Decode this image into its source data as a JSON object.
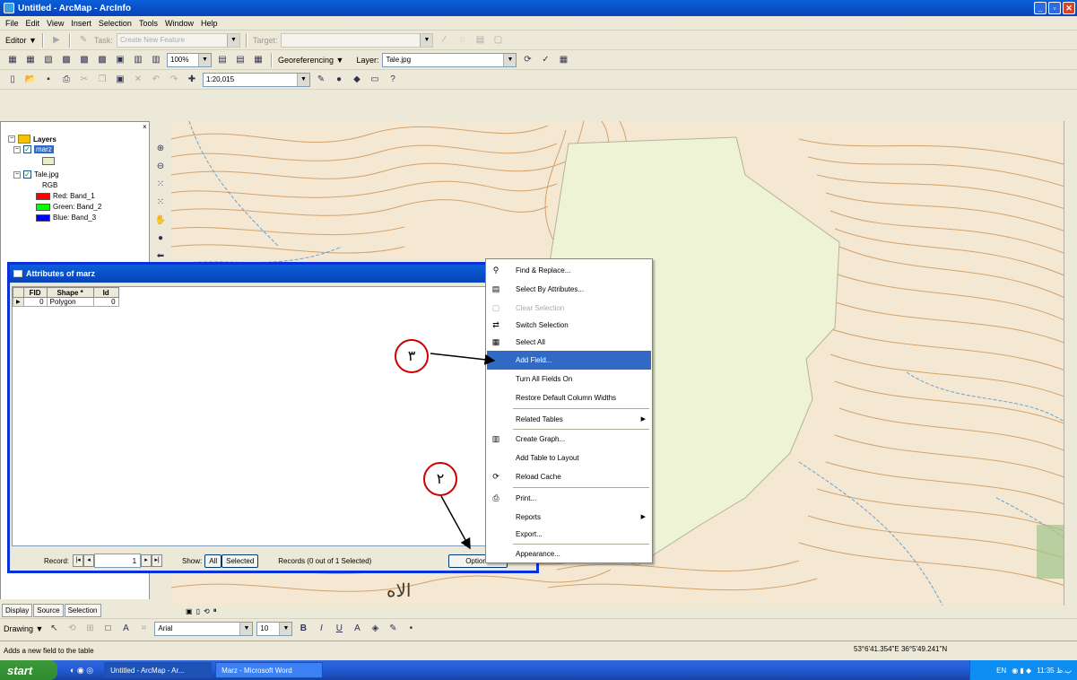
{
  "window": {
    "title": "Untitled - ArcMap - ArcInfo"
  },
  "menu": [
    "File",
    "Edit",
    "View",
    "Insert",
    "Selection",
    "Tools",
    "Window",
    "Help"
  ],
  "editor_toolbar": {
    "editor": "Editor ▼",
    "task_label": "Task:",
    "task_value": "Create New Feature",
    "target_label": "Target:"
  },
  "georef_toolbar": {
    "zoom": "100%",
    "georeferencing": "Georeferencing ▼",
    "layer_label": "Layer:",
    "layer_value": "Tale.jpg"
  },
  "standard_toolbar": {
    "scale": "1:20,015"
  },
  "toc": {
    "layers": "Layers",
    "marz": "marz",
    "tale": "Tale.jpg",
    "rgb": "RGB",
    "bands": [
      {
        "label": "Red:  Band_1",
        "color": "#ff0000"
      },
      {
        "label": "Green: Band_2",
        "color": "#00ff00"
      },
      {
        "label": "Blue:  Band_3",
        "color": "#0000ff"
      }
    ],
    "tabs": [
      "Display",
      "Source",
      "Selection"
    ]
  },
  "attributes": {
    "title": "Attributes of marz",
    "columns": [
      "FID",
      "Shape *",
      "Id"
    ],
    "rows": [
      [
        "0",
        "Polygon",
        "0"
      ]
    ],
    "record_label": "Record:",
    "record_value": "1",
    "show_label": "Show:",
    "all_btn": "All",
    "selected_btn": "Selected",
    "records_status": "Records (0 out of 1 Selected)",
    "options_btn": "Options"
  },
  "context_menu": [
    {
      "label": "Find & Replace...",
      "icon": "binoculars-icon"
    },
    {
      "label": "Select By Attributes...",
      "icon": "select-attributes-icon"
    },
    {
      "label": "Clear Selection",
      "icon": "clear-selection-icon",
      "disabled": true
    },
    {
      "label": "Switch Selection",
      "icon": "switch-selection-icon"
    },
    {
      "label": "Select All",
      "icon": "select-all-icon"
    },
    {
      "label": "Add Field...",
      "highlight": true
    },
    {
      "label": "Turn All Fields On"
    },
    {
      "label": "Restore Default Column Widths"
    },
    {
      "label": "Related Tables",
      "submenu": true
    },
    {
      "label": "Create Graph...",
      "icon": "graph-icon"
    },
    {
      "label": "Add Table to Layout"
    },
    {
      "label": "Reload Cache",
      "icon": "reload-icon"
    },
    {
      "label": "Print...",
      "icon": "print-icon"
    },
    {
      "label": "Reports",
      "submenu": true
    },
    {
      "label": "Export..."
    },
    {
      "label": "Appearance..."
    }
  ],
  "annotations": {
    "step3": "٣",
    "step2": "٢"
  },
  "map_labels": {
    "label1": "الاه"
  },
  "drawing_toolbar": {
    "drawing": "Drawing ▼",
    "font": "Arial",
    "size": "10"
  },
  "status": {
    "message": "Adds a new field to the table",
    "coords": "53°6'41.354\"E  36°5'49.241\"N"
  },
  "taskbar": {
    "start": "start",
    "tasks": [
      "Untitled - ArcMap - Ar...",
      "Marz - Microsoft Word"
    ],
    "lang": "EN",
    "time": "11:35 ب.ظ"
  }
}
